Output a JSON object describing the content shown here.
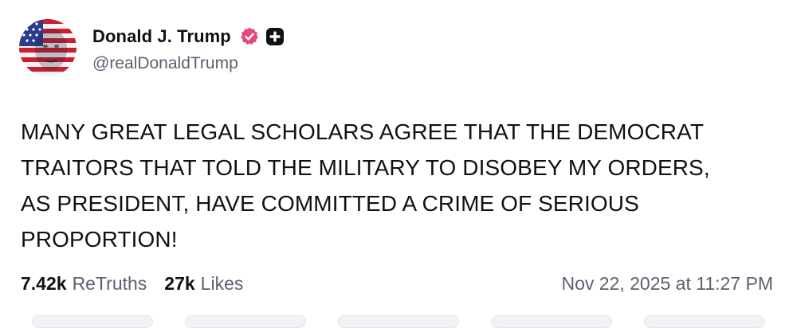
{
  "author": {
    "display_name": "Donald J. Trump",
    "handle": "@realDonaldTrump",
    "verified_badge_color": "#e5487a",
    "avatar_icon": "user-avatar-flag"
  },
  "post": {
    "text": "MANY GREAT LEGAL SCHOLARS AGREE THAT THE DEMOCRAT TRAITORS THAT TOLD THE MILITARY TO DISOBEY MY ORDERS, AS PRESIDENT, HAVE COMMITTED A CRIME OF SERIOUS PROPORTION!",
    "text_lines": [
      "MANY GREAT LEGAL SCHOLARS AGREE THAT THE DEMOCRAT",
      "TRAITORS THAT TOLD THE MILITARY TO DISOBEY MY ORDERS,",
      "AS PRESIDENT, HAVE COMMITTED A CRIME OF SERIOUS",
      "PROPORTION!"
    ]
  },
  "stats": {
    "retruths_count": "7.42k",
    "retruths_label": "ReTruths",
    "likes_count": "27k",
    "likes_label": "Likes"
  },
  "timestamp": "Nov 22, 2025 at 11:27 PM",
  "colors": {
    "text": "#111111",
    "muted": "#5b6170",
    "background": "#ffffff"
  }
}
